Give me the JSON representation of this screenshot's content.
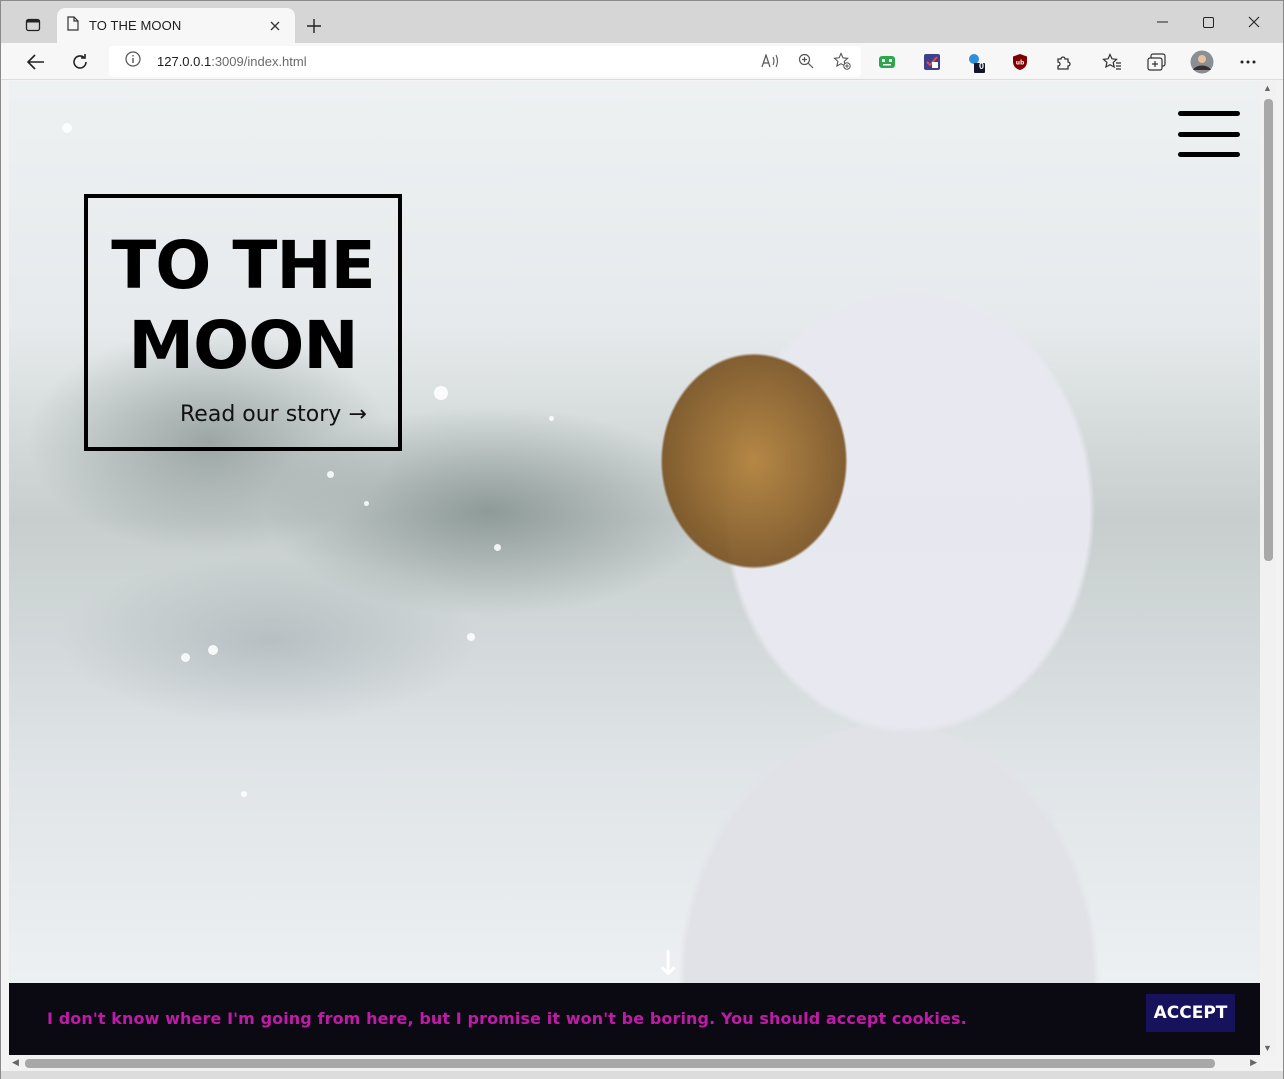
{
  "browser": {
    "tab_title": "TO THE MOON",
    "url_host": "127.0.0.1",
    "url_rest": ":3009/index.html",
    "extension_badge": "0"
  },
  "page": {
    "title_line1": "TO THE",
    "title_line2": "MOON",
    "story_link": "Read our story →",
    "scroll_arrow": "↓",
    "cookie_message": "I don't know where I'm going from here, but I promise it won't be boring. You should accept cookies.",
    "accept_label": "ACCEPT"
  },
  "colors": {
    "cookie_bg": "#0b0a12",
    "cookie_text": "#c21aa8",
    "accept_bg": "#17125c"
  }
}
